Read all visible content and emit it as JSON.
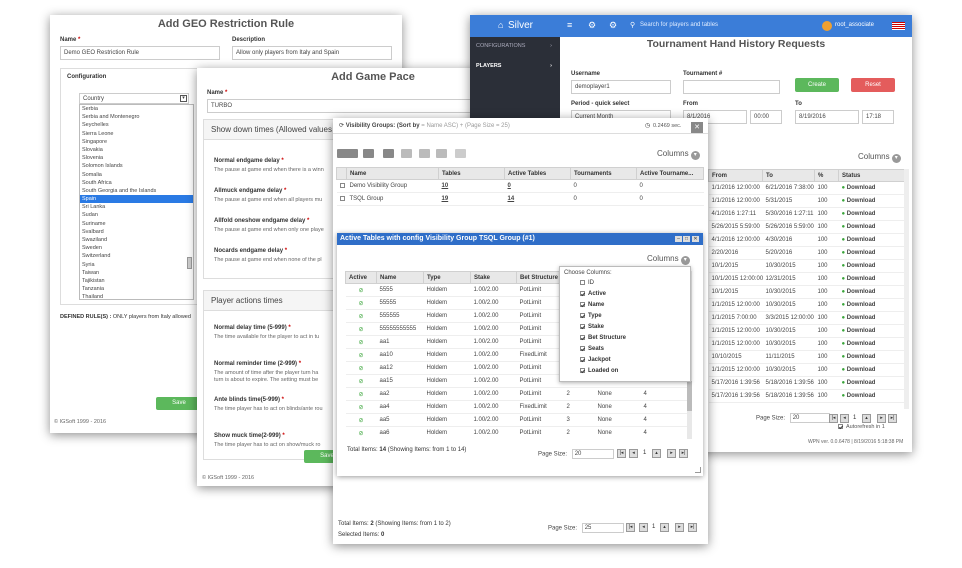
{
  "geo": {
    "title": "Add GEO Restriction Rule",
    "name_label": "Name",
    "name_value": "Demo GEO Restriction Rule",
    "desc_label": "Description",
    "desc_value": "Allow  only players from Italy and Spain",
    "config_label": "Configuration",
    "country_label": "Country",
    "countries": [
      "Serbia",
      "Serbia and Montenegro",
      "Seychelles",
      "Sierra Leone",
      "Singapore",
      "Slovakia",
      "Slovenia",
      "Solomon Islands",
      "Somalia",
      "South Africa",
      "South Georgia and the Islands",
      "Spain",
      "Sri Lanka",
      "Sudan",
      "Suriname",
      "Svalbard",
      "Swaziland",
      "Sweden",
      "Switzerland",
      "Syria",
      "Taiwan",
      "Tajikistan",
      "Tanzania",
      "Thailand"
    ],
    "selected_country": "Spain",
    "rules_label": "DEFINED RULE(S) :",
    "rules_value": "ONLY players from Italy allowed",
    "save_label": "Save",
    "footer": "© IGSoft 1999 - 2016"
  },
  "pace": {
    "title": "Add Game Pace",
    "name_label": "Name",
    "name_value": "TURBO",
    "showdown_header": "Show down times (Allowed values f",
    "fields1": [
      {
        "label": "Normal endgame delay",
        "desc": "The pause at game end when there is a winn"
      },
      {
        "label": "Allmuck endgame delay",
        "desc": "The pause at game end when all players mu"
      },
      {
        "label": "Allfold oneshow endgame delay",
        "desc": "The pause at game end when only one playe"
      },
      {
        "label": "Nocards endgame delay",
        "desc": "The pause at game end when none of the pl"
      }
    ],
    "actions_header": "Player actions times",
    "fields2": [
      {
        "label": "Normal delay time (5-999)",
        "desc": "The time available for the player to act in tu"
      },
      {
        "label": "Normal reminder time (2-999)",
        "desc": "The amount of time after the player turn ha",
        "desc2": "turn is about to expire. The setting must be"
      },
      {
        "label": "Ante blinds time(5-999)",
        "desc": "The time player has to act on blinds/ante rou"
      },
      {
        "label": "Show muck time(2-999)",
        "desc": "The time player has to act on show/muck ro"
      }
    ],
    "save_label": "Save",
    "footer": "© IGSoft 1999 - 2016"
  },
  "silver": {
    "brand": "Silver",
    "search_placeholder": "Search for players and tables",
    "user": "root_associate",
    "nav": [
      "CONFIGURATIONS",
      "PLAYERS"
    ],
    "title": "Tournament Hand History Requests",
    "username_label": "Username",
    "username_value": "demoplayer1",
    "tournament_label": "Tournament #",
    "create_label": "Create",
    "reset_label": "Reset",
    "period_label": "Period - quick select",
    "period_value": "Current Month",
    "from_label": "From",
    "from_date": "8/1/2016",
    "from_time": "00:00",
    "to_label": "To",
    "to_date": "8/19/2016",
    "to_time": "17:18",
    "columns_label": "Columns",
    "headers": [
      "From",
      "To",
      "%",
      "Status"
    ],
    "rows": [
      [
        "1/1/2016 12:00:00",
        "6/21/2016 7:38:00",
        "100",
        "Download"
      ],
      [
        "1/1/2016 12:00:00",
        "5/31/2015",
        "100",
        "Download"
      ],
      [
        "4/1/2016 1:27:11",
        "5/30/2016 1:27:11",
        "100",
        "Download"
      ],
      [
        "5/26/2015 5:59:00",
        "5/26/2016 5:59:00",
        "100",
        "Download"
      ],
      [
        "4/1/2016 12:00:00",
        "4/30/2016",
        "100",
        "Download"
      ],
      [
        "2/20/2016",
        "5/20/2016",
        "100",
        "Download"
      ],
      [
        "10/1/2015",
        "10/30/2015",
        "100",
        "Download"
      ],
      [
        "10/1/2015 12:00:00",
        "12/31/2015",
        "100",
        "Download"
      ],
      [
        "10/1/2015",
        "10/30/2015",
        "100",
        "Download"
      ],
      [
        "1/1/2015 12:00:00",
        "10/30/2015",
        "100",
        "Download"
      ],
      [
        "1/1/2015 7:00:00",
        "3/3/2015 12:00:00",
        "100",
        "Download"
      ],
      [
        "1/1/2015 12:00:00",
        "10/30/2015",
        "100",
        "Download"
      ],
      [
        "1/1/2015 12:00:00",
        "10/30/2015",
        "100",
        "Download"
      ],
      [
        "10/10/2015",
        "11/11/2015",
        "100",
        "Download"
      ],
      [
        "1/1/2015 12:00:00",
        "10/30/2015",
        "100",
        "Download"
      ],
      [
        "5/17/2016 1:39:56",
        "5/18/2016 1:39:56",
        "100",
        "Download"
      ],
      [
        "5/17/2016 1:39:56",
        "5/18/2016 1:39:56",
        "100",
        "Download"
      ]
    ],
    "page_size_label": "Page Size:",
    "page_size": "20",
    "page": "1",
    "autorefresh": "Autorefresh in 1",
    "footer": "WPN ver. 0.0.6478 | 8/19/2016 5:18:38 PM"
  },
  "vis": {
    "header_prefix": "Visibility Groups: (Sort by",
    "header_sort": "= Name ASC) + (Page Size",
    "header_size": "= 25)",
    "timing": "0.2469 sec.",
    "columns_label": "Columns",
    "headers": [
      "Name",
      "Tables",
      "Active Tables",
      "Tournaments",
      "Active Tourname..."
    ],
    "rows": [
      [
        "Demo Visibility Group",
        "10",
        "0",
        "0",
        "0"
      ],
      [
        "TSQL Group",
        "19",
        "14",
        "0",
        "0"
      ]
    ],
    "total": "Total Items:",
    "total_count": "2",
    "total_rest": "(Showing Items: from 1 to 2)",
    "selected": "Selected Items:",
    "selected_count": "0",
    "page_size_label": "Page Size:",
    "page_size": "25",
    "page": "1"
  },
  "active": {
    "title": "Active Tables with config Visibility Group TSQL Group (#1)",
    "columns_label": "Columns",
    "headers": [
      "Active",
      "Name",
      "Type",
      "Stake",
      "Bet Structure"
    ],
    "rows": [
      [
        "5555",
        "Holdem",
        "1.00/2.00",
        "PotLimit",
        "",
        "",
        ""
      ],
      [
        "55555",
        "Holdem",
        "1.00/2.00",
        "PotLimit",
        "",
        "",
        ""
      ],
      [
        "555555",
        "Holdem",
        "1.00/2.00",
        "PotLimit",
        "",
        "",
        ""
      ],
      [
        "55555555555",
        "Holdem",
        "1.00/2.00",
        "PotLimit",
        "",
        "",
        ""
      ],
      [
        "aa1",
        "Holdem",
        "1.00/2.00",
        "PotLimit",
        "",
        "",
        ""
      ],
      [
        "aa10",
        "Holdem",
        "1.00/2.00",
        "FixedLimit",
        "",
        "",
        ""
      ],
      [
        "aa12",
        "Holdem",
        "1.00/2.00",
        "PotLimit",
        "",
        "",
        ""
      ],
      [
        "aa15",
        "Holdem",
        "1.00/2.00",
        "PotLimit",
        "",
        "",
        ""
      ],
      [
        "aa2",
        "Holdem",
        "1.00/2.00",
        "PotLimit",
        "2",
        "None",
        "4"
      ],
      [
        "aa4",
        "Holdem",
        "1.00/2.00",
        "FixedLimit",
        "2",
        "None",
        "4"
      ],
      [
        "aa5",
        "Holdem",
        "1.00/2.00",
        "PotLimit",
        "3",
        "None",
        "4"
      ],
      [
        "aa6",
        "Holdem",
        "1.00/2.00",
        "PotLimit",
        "2",
        "None",
        "4"
      ]
    ],
    "choose_title": "Choose Columns:",
    "choose": [
      {
        "label": "ID",
        "on": false
      },
      {
        "label": "Active",
        "on": true
      },
      {
        "label": "Name",
        "on": true
      },
      {
        "label": "Type",
        "on": true
      },
      {
        "label": "Stake",
        "on": true
      },
      {
        "label": "Bet Structure",
        "on": true
      },
      {
        "label": "Seats",
        "on": true
      },
      {
        "label": "Jackpot",
        "on": true
      },
      {
        "label": "Loaded on",
        "on": true
      }
    ],
    "total": "Total Items:",
    "total_count": "14",
    "total_rest": "(Showing Items: from 1 to 14)",
    "page_size_label": "Page Size:",
    "page_size": "20",
    "page": "1"
  }
}
